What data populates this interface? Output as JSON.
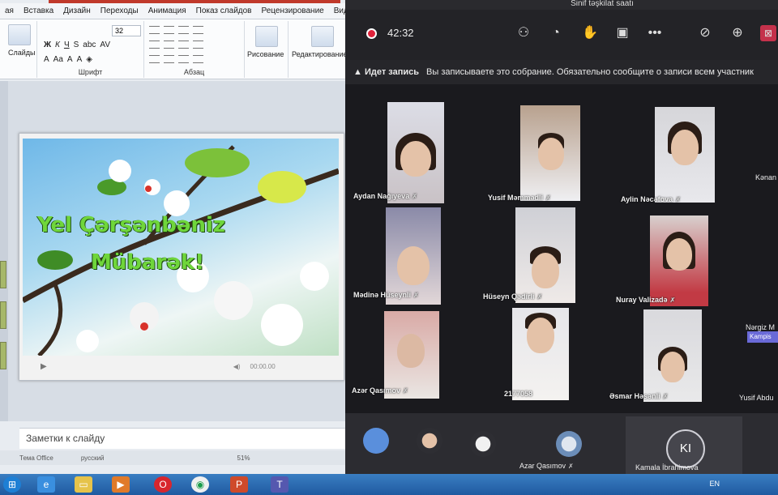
{
  "powerpoint": {
    "tabs": [
      "ая",
      "Вставка",
      "Дизайн",
      "Переходы",
      "Анимация",
      "Показ слайдов",
      "Рецензирование",
      "Вид"
    ],
    "ribbon": {
      "slides_label": "Слайды",
      "font_size": "32",
      "font_group_label": "Шрифт",
      "paragraph_group_label": "Абзац",
      "drawing_label": "Рисование",
      "editing_label": "Редактирование"
    },
    "slide": {
      "title_line1": "Yel Çərşənbəniz",
      "title_line2": "Mübarək!",
      "media_time": "00:00.00"
    },
    "notes_placeholder": "Заметки к слайду",
    "status": {
      "theme": "Тема Office",
      "language": "русский",
      "zoom": "51%"
    }
  },
  "teams": {
    "window_title": "Sinif təşkilat saatı",
    "call_time": "42:32",
    "recording_banner": {
      "bold": "Идет запись",
      "text": "Вы записываете это собрание. Обязательно сообщите о записи всем участник"
    },
    "participants": [
      {
        "name": "Aydan Nağıyeva"
      },
      {
        "name": "Yusif Məmmədli"
      },
      {
        "name": "Aylin Nəcəfova"
      },
      {
        "name": "Mədinə Hüseynli"
      },
      {
        "name": "Hüseyn Qədirli"
      },
      {
        "name": "Nuray Valizadə"
      },
      {
        "name": "Azər Qasımov"
      },
      {
        "name": "2177058"
      },
      {
        "name": "Əsmar Həsənli"
      }
    ],
    "side_names": [
      "Kənan",
      "Kampis",
      "Nərgiz M",
      "Yusif Abdu"
    ],
    "bottom_strip": {
      "names": [
        "Azar Qasımov",
        "Kamala İbrahimova"
      ],
      "initials": "KI"
    }
  },
  "taskbar": {
    "language": "EN"
  },
  "colors": {
    "recording_red": "#e0223b",
    "teams_bg": "#1f1f23",
    "taskbar_blue": "#1f5aa0",
    "slide_text_green": "#6fd63b"
  }
}
